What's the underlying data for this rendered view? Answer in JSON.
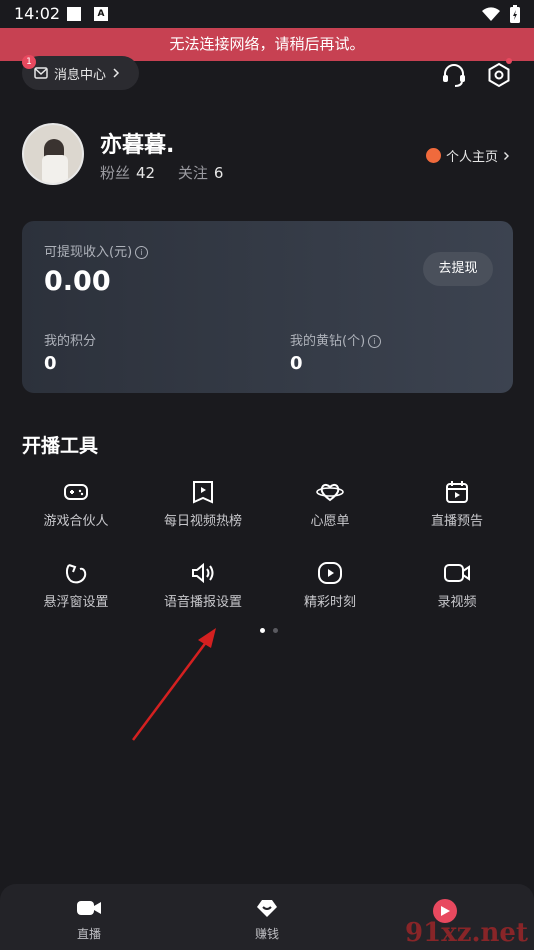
{
  "status_bar": {
    "time": "14:02",
    "a_label": "A"
  },
  "banner": {
    "text": "无法连接网络，请稍后再试。"
  },
  "header": {
    "message_center": "消息中心",
    "message_badge": "1"
  },
  "profile": {
    "name": "亦暮暮.",
    "fans_label": "粉丝",
    "fans_count": "42",
    "follow_label": "关注",
    "follow_count": "6",
    "homepage_link": "个人主页"
  },
  "earnings_card": {
    "withdrawable_label": "可提现收入(元)",
    "withdrawable_amount": "0.00",
    "withdraw_button": "去提现",
    "points_label": "我的积分",
    "points_value": "0",
    "diamond_label": "我的黄钻(个)",
    "diamond_value": "0"
  },
  "tools": {
    "title": "开播工具",
    "items": [
      {
        "label": "游戏合伙人",
        "icon": "gamepad-icon"
      },
      {
        "label": "每日视频热榜",
        "icon": "video-rank-icon"
      },
      {
        "label": "心愿单",
        "icon": "wishlist-icon"
      },
      {
        "label": "直播预告",
        "icon": "calendar-play-icon"
      },
      {
        "label": "悬浮窗设置",
        "icon": "floating-window-icon"
      },
      {
        "label": "语音播报设置",
        "icon": "speaker-icon"
      },
      {
        "label": "精彩时刻",
        "icon": "highlight-play-icon"
      },
      {
        "label": "录视频",
        "icon": "record-video-icon"
      }
    ],
    "page_count": 2,
    "current_page": 1
  },
  "tabbar": {
    "items": [
      {
        "label": "直播",
        "icon": "camera-icon"
      },
      {
        "label": "赚钱",
        "icon": "money-icon"
      },
      {
        "label": "",
        "icon": "me-icon"
      }
    ]
  },
  "watermark": {
    "text": "91xz.net"
  },
  "colors": {
    "banner": "#c74152",
    "accent_red": "#e8495f",
    "background": "#1a1a1e"
  }
}
